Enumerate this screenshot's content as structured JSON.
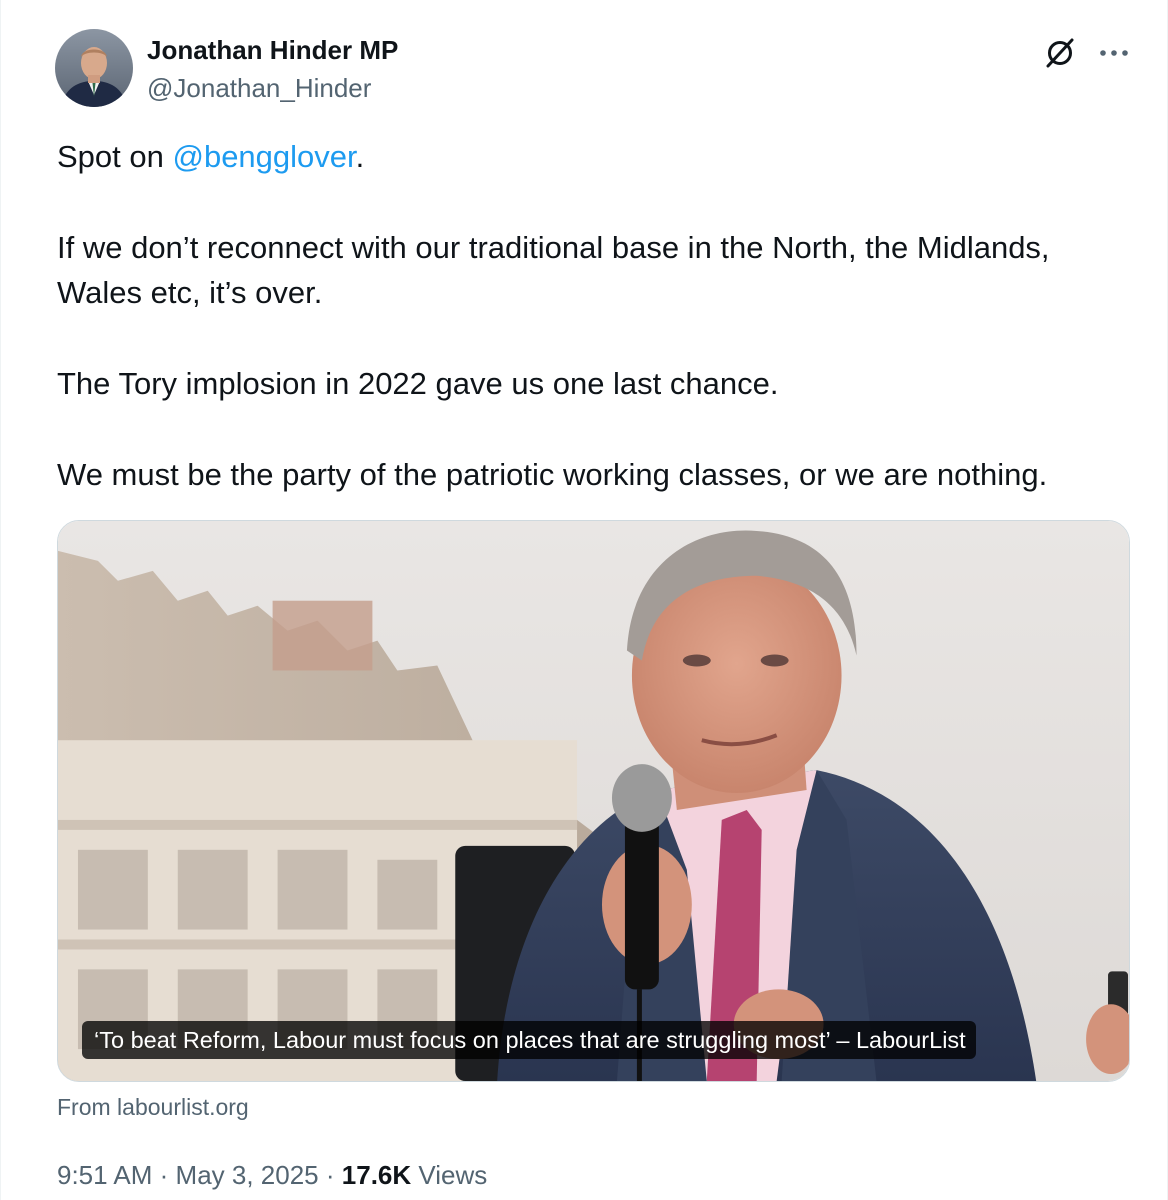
{
  "author": {
    "name": "Jonathan Hinder MP",
    "handle": "@Jonathan_Hinder"
  },
  "tweet": {
    "mention": "@bengglover",
    "line1_prefix": "Spot on ",
    "line1_suffix": ".",
    "para2": "If we don’t reconnect with our traditional base in the North, the Midlands, Wales etc, it’s over.",
    "para3": "The Tory implosion in 2022 gave us one last chance.",
    "para4": "We must be the party of the patriotic working classes, or we are nothing."
  },
  "card": {
    "caption": "‘To beat Reform, Labour must focus on places that are struggling most’ – LabourList",
    "source": "From labourlist.org"
  },
  "meta": {
    "time": "9:51 AM",
    "separator": "·",
    "date": "May 3, 2025",
    "views_count": "17.6K",
    "views_label": "Views"
  },
  "icons": {
    "grok": "grok-icon",
    "more": "more-icon"
  },
  "colors": {
    "link": "#1d9bf0",
    "secondary_text": "#536471",
    "primary_text": "#0f1419",
    "border": "#cfd9de"
  }
}
